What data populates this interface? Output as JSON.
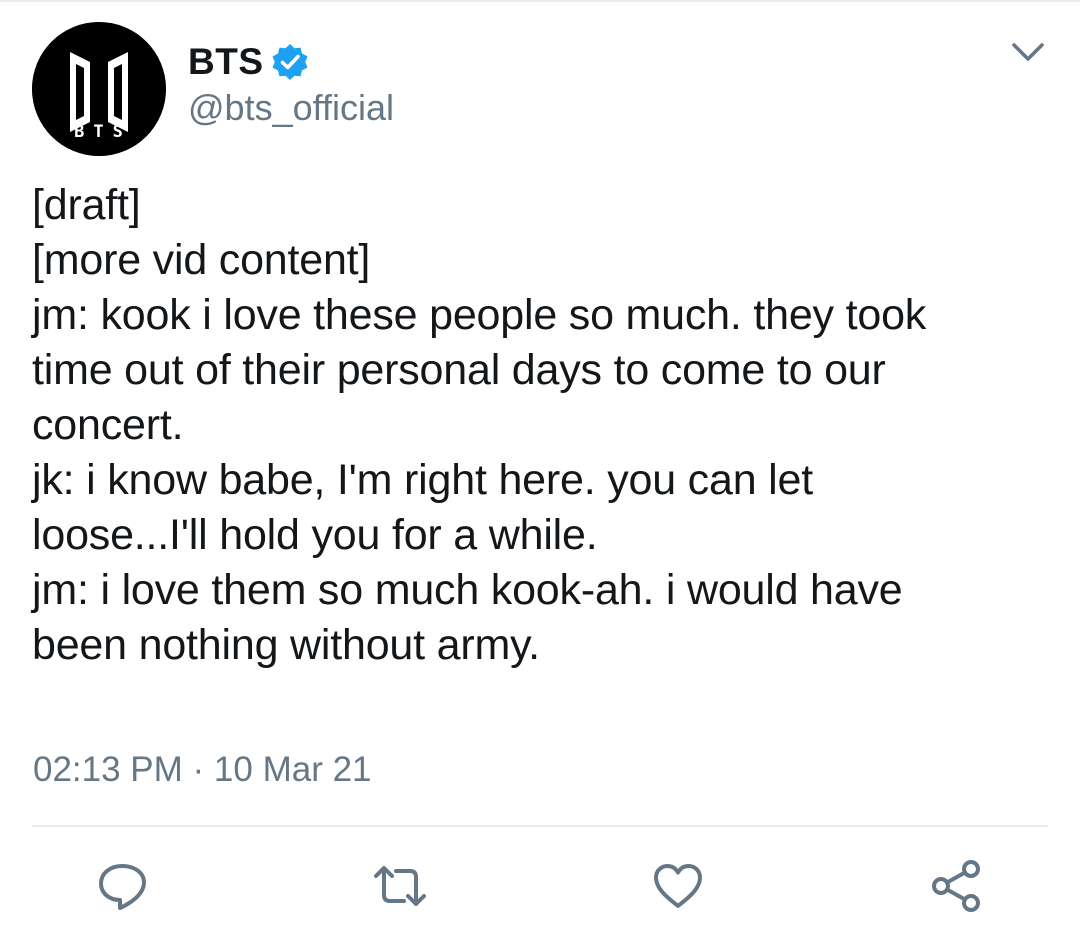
{
  "account": {
    "display_name": "BTS",
    "handle": "@bts_official",
    "verified": true,
    "avatar_text": "BTS"
  },
  "tweet": {
    "lines": [
      "[draft]",
      "[more vid content]",
      "jm: kook i love these people so much. they took",
      "time out of their personal days to come to our",
      "concert.",
      "jk: i know babe, I'm right here. you can let",
      "loose...I'll hold you for a while.",
      "jm: i love them so much kook-ah. i would have",
      "been nothing without army."
    ],
    "timestamp": "02:13 PM · 10 Mar 21"
  },
  "actions": {
    "icons": [
      "reply-icon",
      "retweet-icon",
      "like-icon",
      "share-icon"
    ]
  },
  "colors": {
    "text": "#14171a",
    "secondary": "#657786",
    "verified_blue": "#1da1f2",
    "divider": "#e6ecf0"
  }
}
